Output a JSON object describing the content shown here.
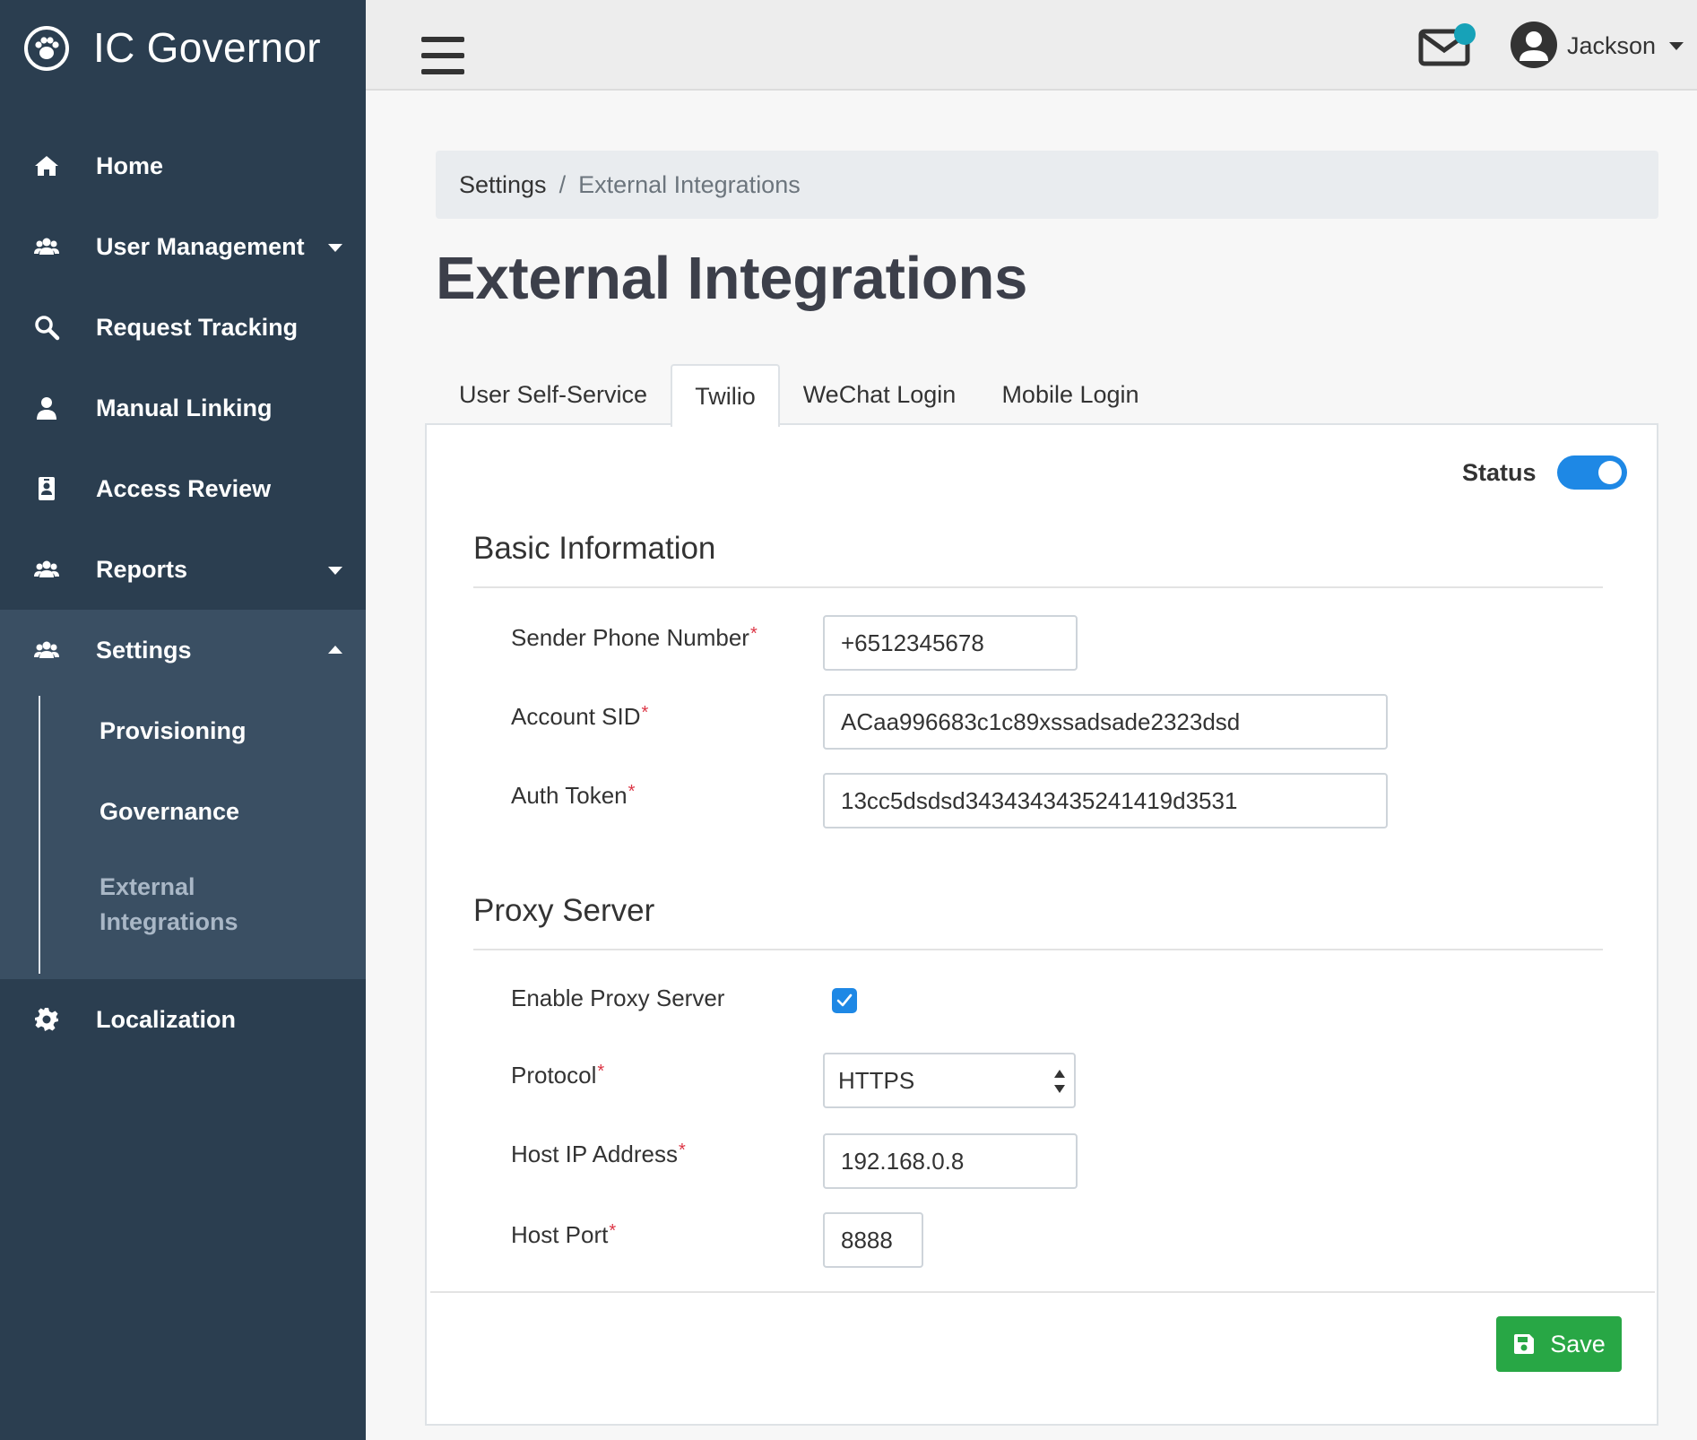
{
  "app": {
    "name": "IC Governor"
  },
  "sidebar": {
    "items": [
      {
        "label": "Home",
        "icon": "home-icon"
      },
      {
        "label": "User Management",
        "icon": "users-icon"
      },
      {
        "label": "Request Tracking",
        "icon": "search-icon"
      },
      {
        "label": "Manual Linking",
        "icon": "user-icon"
      },
      {
        "label": "Access Review",
        "icon": "id-badge-icon"
      },
      {
        "label": "Reports",
        "icon": "users-icon"
      },
      {
        "label": "Settings",
        "icon": "users-icon"
      },
      {
        "label": "Localization",
        "icon": "gear-icon"
      }
    ],
    "settings_sub": [
      "Provisioning",
      "Governance",
      "External Integrations"
    ]
  },
  "topbar": {
    "user_name": "Jackson",
    "notification_color": "#17a2b8"
  },
  "breadcrumb": {
    "parent": "Settings",
    "separator": "/",
    "current": "External Integrations"
  },
  "page": {
    "title": "External Integrations"
  },
  "tabs": [
    "User Self-Service",
    "Twilio",
    "WeChat Login",
    "Mobile Login"
  ],
  "panel": {
    "status_label": "Status",
    "status_on": true,
    "basic": {
      "title": "Basic Information",
      "sender_label": "Sender Phone Number",
      "sender_value": "+6512345678",
      "sid_label": "Account SID",
      "sid_value": "ACaa996683c1c89xssadsade2323dsd",
      "token_label": "Auth Token",
      "token_value": "13cc5dsdsd3434343435241419d3531"
    },
    "proxy": {
      "title": "Proxy Server",
      "enable_label": "Enable Proxy Server",
      "enabled": true,
      "protocol_label": "Protocol",
      "protocol_value": "HTTPS",
      "host_label": "Host IP Address",
      "host_value": "192.168.0.8",
      "port_label": "Host Port",
      "port_value": "8888"
    },
    "required_mark": "*",
    "save_label": "Save"
  },
  "colors": {
    "sidebar": "#2b3e50",
    "accent": "#1e88e5",
    "success": "#28a745"
  }
}
